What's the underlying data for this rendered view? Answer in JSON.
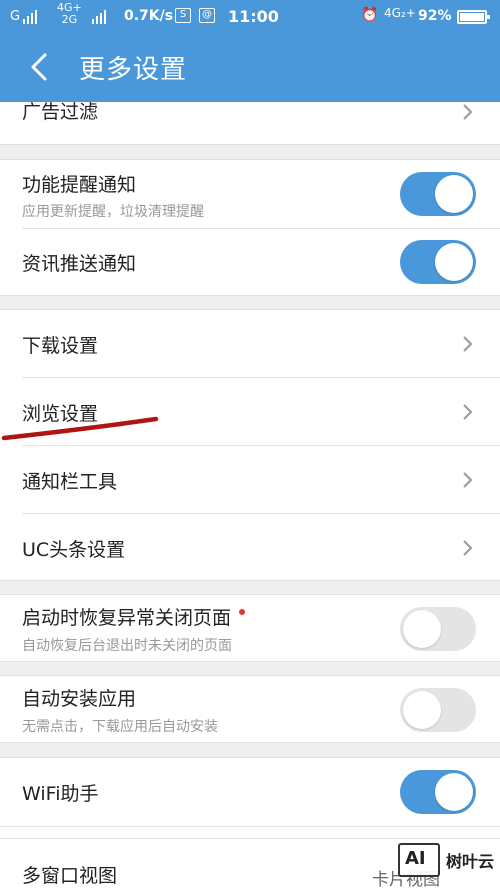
{
  "status_bar": {
    "net1": "G",
    "net2_top": "4G+",
    "net2_bottom": "2G",
    "speed": "0.7K/s",
    "time": "11:00",
    "net3": "4G₂+",
    "battery": "92%"
  },
  "header": {
    "title": "更多设置"
  },
  "settings": {
    "ad_filter": {
      "label": "广告过滤"
    },
    "feature_notice": {
      "label": "功能提醒通知",
      "sub": "应用更新提醒，垃圾清理提醒",
      "enabled": true
    },
    "news_push": {
      "label": "资讯推送通知",
      "enabled": true
    },
    "download": {
      "label": "下载设置"
    },
    "browse": {
      "label": "浏览设置"
    },
    "notify_tools": {
      "label": "通知栏工具"
    },
    "uc_headline": {
      "label": "UC头条设置"
    },
    "restore_pages": {
      "label": "启动时恢复异常关闭页面",
      "sub": "自动恢复后台退出时未关闭的页面",
      "enabled": false
    },
    "auto_install": {
      "label": "自动安装应用",
      "sub": "无需点击，下载应用后自动安装",
      "enabled": false
    },
    "wifi_assistant": {
      "label": "WiFi助手",
      "enabled": true
    },
    "multi_window": {
      "label": "多窗口视图",
      "value": "卡片视图"
    }
  },
  "watermark": {
    "logo": "AI",
    "text": "树叶云"
  },
  "colors": {
    "primary": "#4a98d9",
    "toggle_off": "#e4e4e4",
    "underline": "#b01515"
  }
}
